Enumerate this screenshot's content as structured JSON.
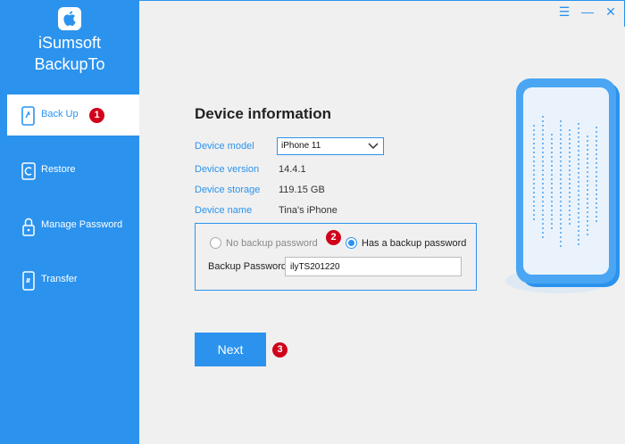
{
  "app": {
    "name_line1": "iSumsoft",
    "name_line2": "BackupTo"
  },
  "sidebar": {
    "items": [
      {
        "label": "Back Up",
        "icon": "backup-phone-icon",
        "active": true
      },
      {
        "label": "Restore",
        "icon": "restore-icon",
        "active": false
      },
      {
        "label": "Manage Password",
        "icon": "lock-phone-icon",
        "active": false
      },
      {
        "label": "Transfer",
        "icon": "transfer-phone-icon",
        "active": false
      }
    ]
  },
  "window_controls": {
    "menu": "☰",
    "minimize": "—",
    "close": "✕"
  },
  "device": {
    "title": "Device information",
    "model_label": "Device model",
    "model_value": "iPhone 11",
    "version_label": "Device version",
    "version_value": "14.4.1",
    "storage_label": "Device storage",
    "storage_value": "119.15 GB",
    "name_label": "Device name",
    "name_value": "Tina's iPhone"
  },
  "backup_password": {
    "option_none": "No backup password",
    "option_has": "Has a backup password",
    "selected": "has",
    "field_label": "Backup Passwords:",
    "field_value": "ilyTS201220"
  },
  "next_label": "Next",
  "badges": [
    "1",
    "2",
    "3"
  ],
  "colors": {
    "accent": "#2b93ee",
    "badge": "#d0021b",
    "background": "#f0f0f0"
  }
}
